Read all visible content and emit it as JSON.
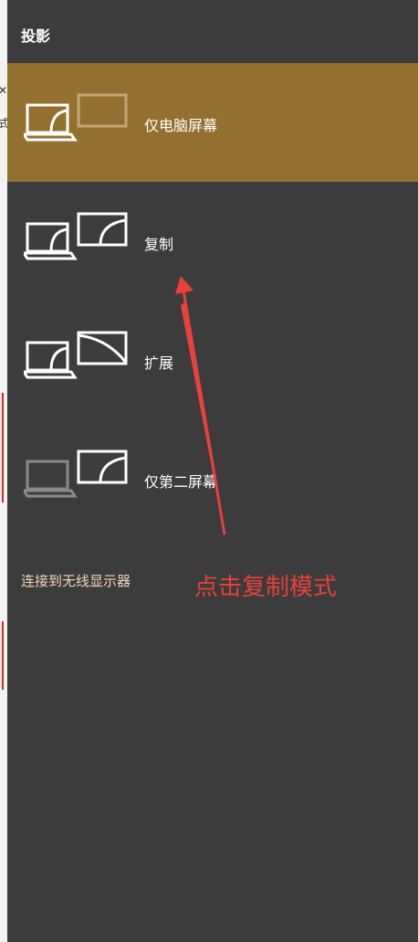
{
  "panel": {
    "title": "投影"
  },
  "options": [
    {
      "label": "仅电脑屏幕",
      "icon": "pc-screen-only-icon",
      "selected": true
    },
    {
      "label": "复制",
      "icon": "duplicate-icon",
      "selected": false
    },
    {
      "label": "扩展",
      "icon": "extend-icon",
      "selected": false
    },
    {
      "label": "仅第二屏幕",
      "icon": "second-screen-only-icon",
      "selected": false
    }
  ],
  "wireless": {
    "label": "连接到无线显示器"
  },
  "annotation": {
    "text": "点击复制模式",
    "color": "#e8403a"
  },
  "colors": {
    "panel_bg": "#3c3c3c",
    "selected_bg": "#937030",
    "link_color": "#f0d8b8"
  }
}
